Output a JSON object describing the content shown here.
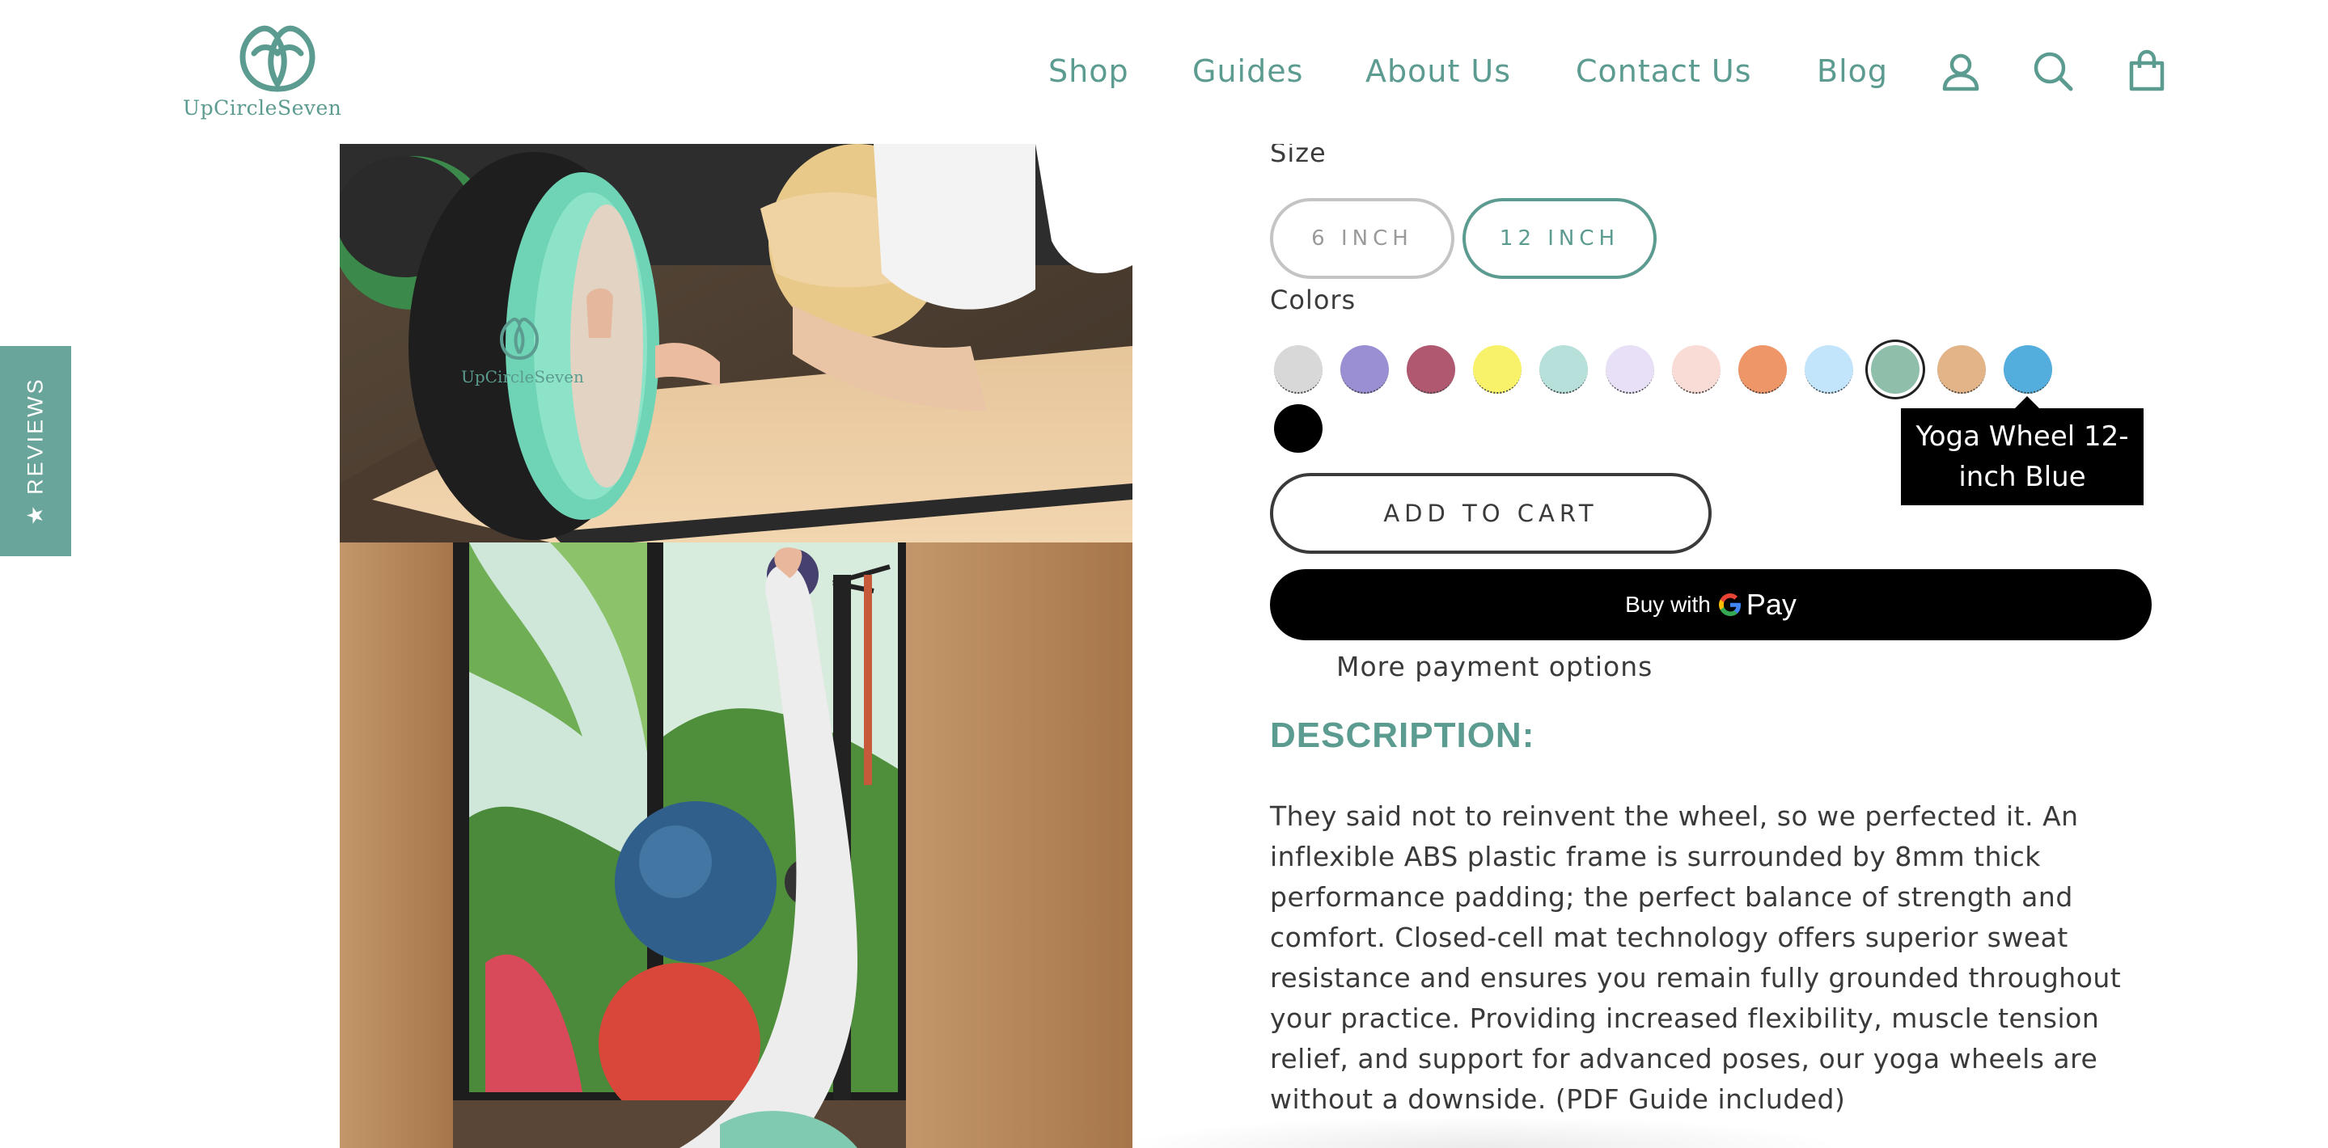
{
  "brand": {
    "name": "UpCircleSeven",
    "logo_text": "UpCircleSeven",
    "color": "#5b9b90"
  },
  "nav": {
    "items": [
      "Shop",
      "Guides",
      "About Us",
      "Contact Us",
      "Blog"
    ],
    "icons": [
      "account-icon",
      "search-icon",
      "cart-icon"
    ]
  },
  "reviews_tab": {
    "label": "★ REVIEWS",
    "color": "#6aa59b"
  },
  "product": {
    "size_label": "Size",
    "sizes": [
      "6 INCH",
      "12 INCH"
    ],
    "selected_size": "12 INCH",
    "colors_label": "Colors",
    "swatches": [
      "#d8d8d8",
      "#9b8fd4",
      "#b05870",
      "#f8f26a",
      "#b7e0db",
      "#e8e0f6",
      "#f9dcd6",
      "#ef9668",
      "#c3e5fb",
      "#8fbfaa",
      "#e2b488",
      "#54aedd",
      "#000000"
    ],
    "selected_swatch_index": 9,
    "hovered_swatch_index": 11,
    "tooltip": "Yoga Wheel 12-inch Blue",
    "add_to_cart": "ADD TO CART",
    "buy_with": "Buy with",
    "buy_pay": "Pay",
    "more_payment": "More payment options",
    "description_title": "DESCRIPTION:",
    "description": "They said not to reinvent the wheel, so we perfected it. An inflexible ABS plastic frame is surrounded by 8mm thick performance padding; the perfect balance of strength and comfort. Closed-cell mat technology offers superior sweat resistance and ensures you remain fully grounded throughout your practice. Providing increased flexibility, muscle tension relief, and support for advanced poses, our yoga wheels are without a downside. (PDF Guide included)"
  },
  "images": {
    "wheel_logo_text": "UpCircleSeven"
  }
}
